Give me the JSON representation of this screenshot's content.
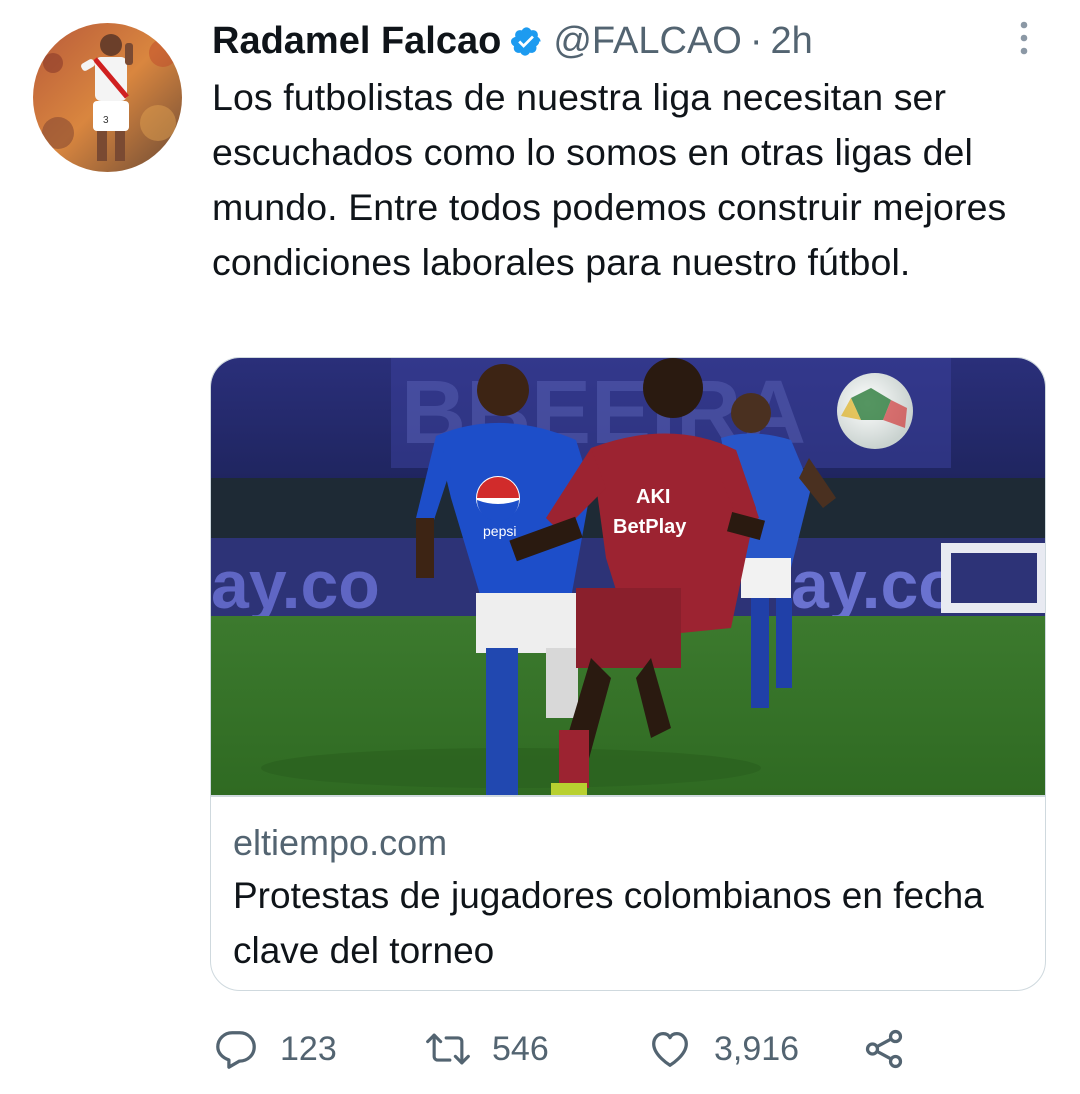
{
  "tweet": {
    "author_name": "Radamel Falcao",
    "handle": "@FALCAO",
    "separator": "·",
    "time": "2h",
    "text": "Los futbolistas de nuestra liga necesitan ser escuchados como lo somos en otras ligas del mundo. Entre todos podemos construir mejores condiciones laborales para nuestro fútbol.",
    "verified": true
  },
  "card": {
    "domain": "eltiempo.com",
    "title": "Protestas de jugadores colombianos en fecha clave del torneo",
    "image_text": {
      "sponsor_left": "ay.co",
      "sponsor_right": "ay.co",
      "shirt_red_1": "AKI",
      "shirt_red_2": "BetPlay",
      "shirt_blue": "pepsi"
    }
  },
  "actions": {
    "reply_count": "123",
    "retweet_count": "546",
    "like_count": "3,916"
  },
  "icons": {
    "verified": "verified-badge-icon",
    "more": "more-vertical-icon",
    "reply": "reply-icon",
    "retweet": "retweet-icon",
    "like": "heart-icon",
    "share": "share-icon"
  },
  "colors": {
    "text_primary": "#0f1419",
    "text_secondary": "#536471",
    "verified_blue": "#1d9bf0",
    "border": "#cfd9de",
    "icon_gray": "#536471"
  }
}
